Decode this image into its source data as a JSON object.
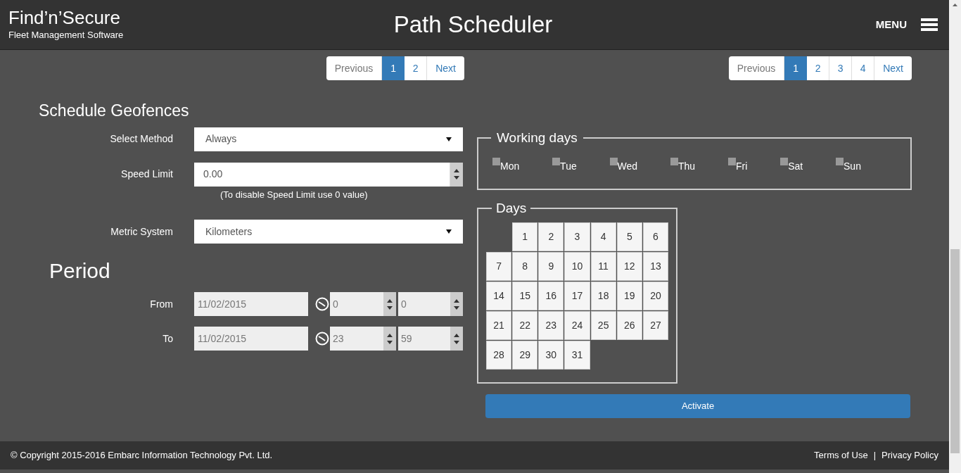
{
  "header": {
    "logo": "Find’n’Secure",
    "tagline": "Fleet Management Software",
    "title": "Path Scheduler",
    "menu_label": "MENU"
  },
  "pagers": [
    {
      "previous": "Previous",
      "pages": [
        {
          "label": "1",
          "selected": true
        },
        {
          "label": "2",
          "selected": false
        }
      ],
      "next": "Next"
    },
    {
      "previous": "Previous",
      "pages": [
        {
          "label": "1",
          "selected": true
        },
        {
          "label": "2",
          "selected": false
        },
        {
          "label": "3",
          "selected": false
        },
        {
          "label": "4",
          "selected": false
        }
      ],
      "next": "Next"
    }
  ],
  "form": {
    "title": "Schedule Geofences",
    "select_method": {
      "label": "Select Method",
      "value": "Always"
    },
    "speed_limit": {
      "label": "Speed Limit",
      "value": "0.00",
      "hint": "(To disable Speed Limit use 0 value)"
    },
    "metric_system": {
      "label": "Metric System",
      "value": "Kilometers"
    }
  },
  "period": {
    "title": "Period",
    "rows": [
      {
        "label": "From",
        "date": "11/02/2015",
        "hour": "0",
        "minute": "0"
      },
      {
        "label": "To",
        "date": "11/02/2015",
        "hour": "23",
        "minute": "59"
      }
    ]
  },
  "working_days": {
    "title": "Working days",
    "days": [
      {
        "label": "Mon",
        "checked": false
      },
      {
        "label": "Tue",
        "checked": false
      },
      {
        "label": "Wed",
        "checked": false
      },
      {
        "label": "Thu",
        "checked": false
      },
      {
        "label": "Fri",
        "checked": false
      },
      {
        "label": "Sat",
        "checked": false
      },
      {
        "label": "Sun",
        "checked": false
      }
    ]
  },
  "days": {
    "title": "Days",
    "weeks": [
      [
        "1",
        "2",
        "3",
        "4",
        "5",
        "6"
      ],
      [
        "7",
        "8",
        "9",
        "10",
        "11",
        "12",
        "13"
      ],
      [
        "14",
        "15",
        "16",
        "17",
        "18",
        "19",
        "20"
      ],
      [
        "21",
        "22",
        "23",
        "24",
        "25",
        "26",
        "27"
      ],
      [
        "28",
        "29",
        "30",
        "31"
      ]
    ]
  },
  "activate_button": "Activate",
  "footer": {
    "copyright": "© Copyright 2015-2016 Embarc Information Technology Pvt. Ltd.",
    "links": [
      "Terms of Use",
      "Privacy Policy"
    ],
    "separator": "|"
  }
}
